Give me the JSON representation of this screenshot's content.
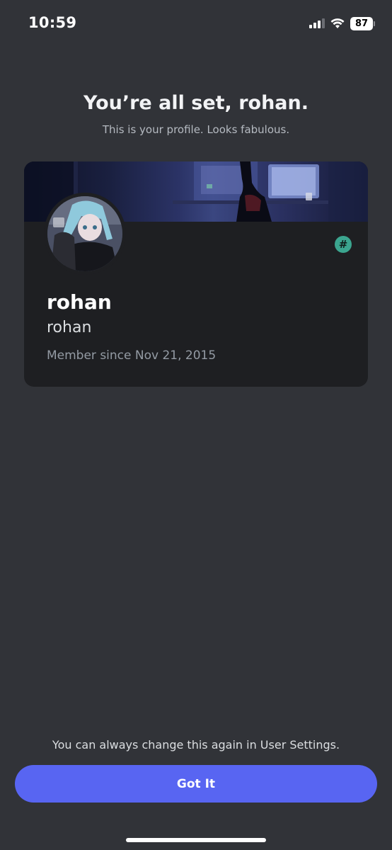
{
  "status_bar": {
    "time": "10:59",
    "battery_level": "87",
    "icons": [
      "cellular-signal-icon",
      "wifi-icon",
      "battery-icon"
    ]
  },
  "header": {
    "title": "You’re all set, rohan.",
    "subtitle": "This is your profile. Looks fabulous."
  },
  "profile": {
    "display_name": "rohan",
    "username": "rohan",
    "member_since": "Member since Nov 21, 2015",
    "badge_symbol": "#",
    "badge_icon": "hashtag-badge-icon"
  },
  "footer": {
    "note": "You can always change this again in User Settings.",
    "button_label": "Got It"
  },
  "colors": {
    "background": "#313338",
    "card": "#1e1f22",
    "accent": "#5865f2",
    "badge": "#3ba58f"
  }
}
